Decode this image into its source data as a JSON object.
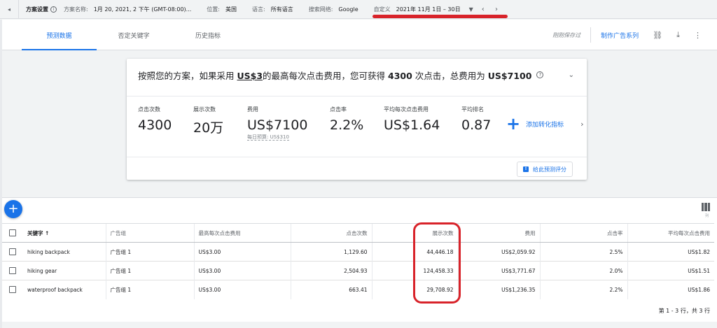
{
  "topbar": {
    "title": "方案设置",
    "plan_name_label": "方案名称:",
    "plan_name": "1月 20, 2021, 2 下午 (GMT-08:00)...",
    "location_label": "位置:",
    "location": "美国",
    "language_label": "语言:",
    "language": "所有语言",
    "network_label": "搜索网络:",
    "network": "Google",
    "date_label": "自定义",
    "date_range": "2021年 11月 1日 – 30日"
  },
  "tabs": [
    "预测数据",
    "否定关键字",
    "历史指标"
  ],
  "header": {
    "saved": "刚刚保存过",
    "create_campaign": "制作广告系列"
  },
  "summary": {
    "pre": "按照您的方案，如果采用 ",
    "bid": "US$3",
    "mid": "的最高每次点击费用，您可获得 ",
    "clicks": "4300",
    "mid2": " 次点击，总费用为 ",
    "cost": "US$7100"
  },
  "metrics": [
    {
      "label": "点击次数",
      "value": "4300"
    },
    {
      "label": "展示次数",
      "value": "20万"
    },
    {
      "label": "费用",
      "value": "US$7100",
      "sub": "每日预算: US$310"
    },
    {
      "label": "点击率",
      "value": "2.2%"
    },
    {
      "label": "平均每次点击费用",
      "value": "US$1.64"
    },
    {
      "label": "平均排名",
      "value": "0.87"
    }
  ],
  "add_conversion": "添加转化指标",
  "feedback": "给此预测评分",
  "table": {
    "headers": [
      "关键字 ↑",
      "广告组",
      "最高每次点击费用",
      "点击次数",
      "展示次数",
      "费用",
      "点击率",
      "平均每次点击费用"
    ],
    "rows": [
      [
        "hiking backpack",
        "广告组 1",
        "US$3.00",
        "1,129.60",
        "44,446.18",
        "US$2,059.92",
        "2.5%",
        "US$1.82"
      ],
      [
        "hiking gear",
        "广告组 1",
        "US$3.00",
        "2,504.93",
        "124,458.33",
        "US$3,771.67",
        "2.0%",
        "US$1.51"
      ],
      [
        "waterproof backpack",
        "广告组 1",
        "US$3.00",
        "663.41",
        "29,708.92",
        "US$1,236.35",
        "2.2%",
        "US$1.86"
      ]
    ],
    "column_icon_label": "列"
  },
  "pager": "第 1 - 3 行，共 3 行",
  "colors": {
    "accent": "#1a73e8",
    "annotation_red": "#d8232a"
  }
}
